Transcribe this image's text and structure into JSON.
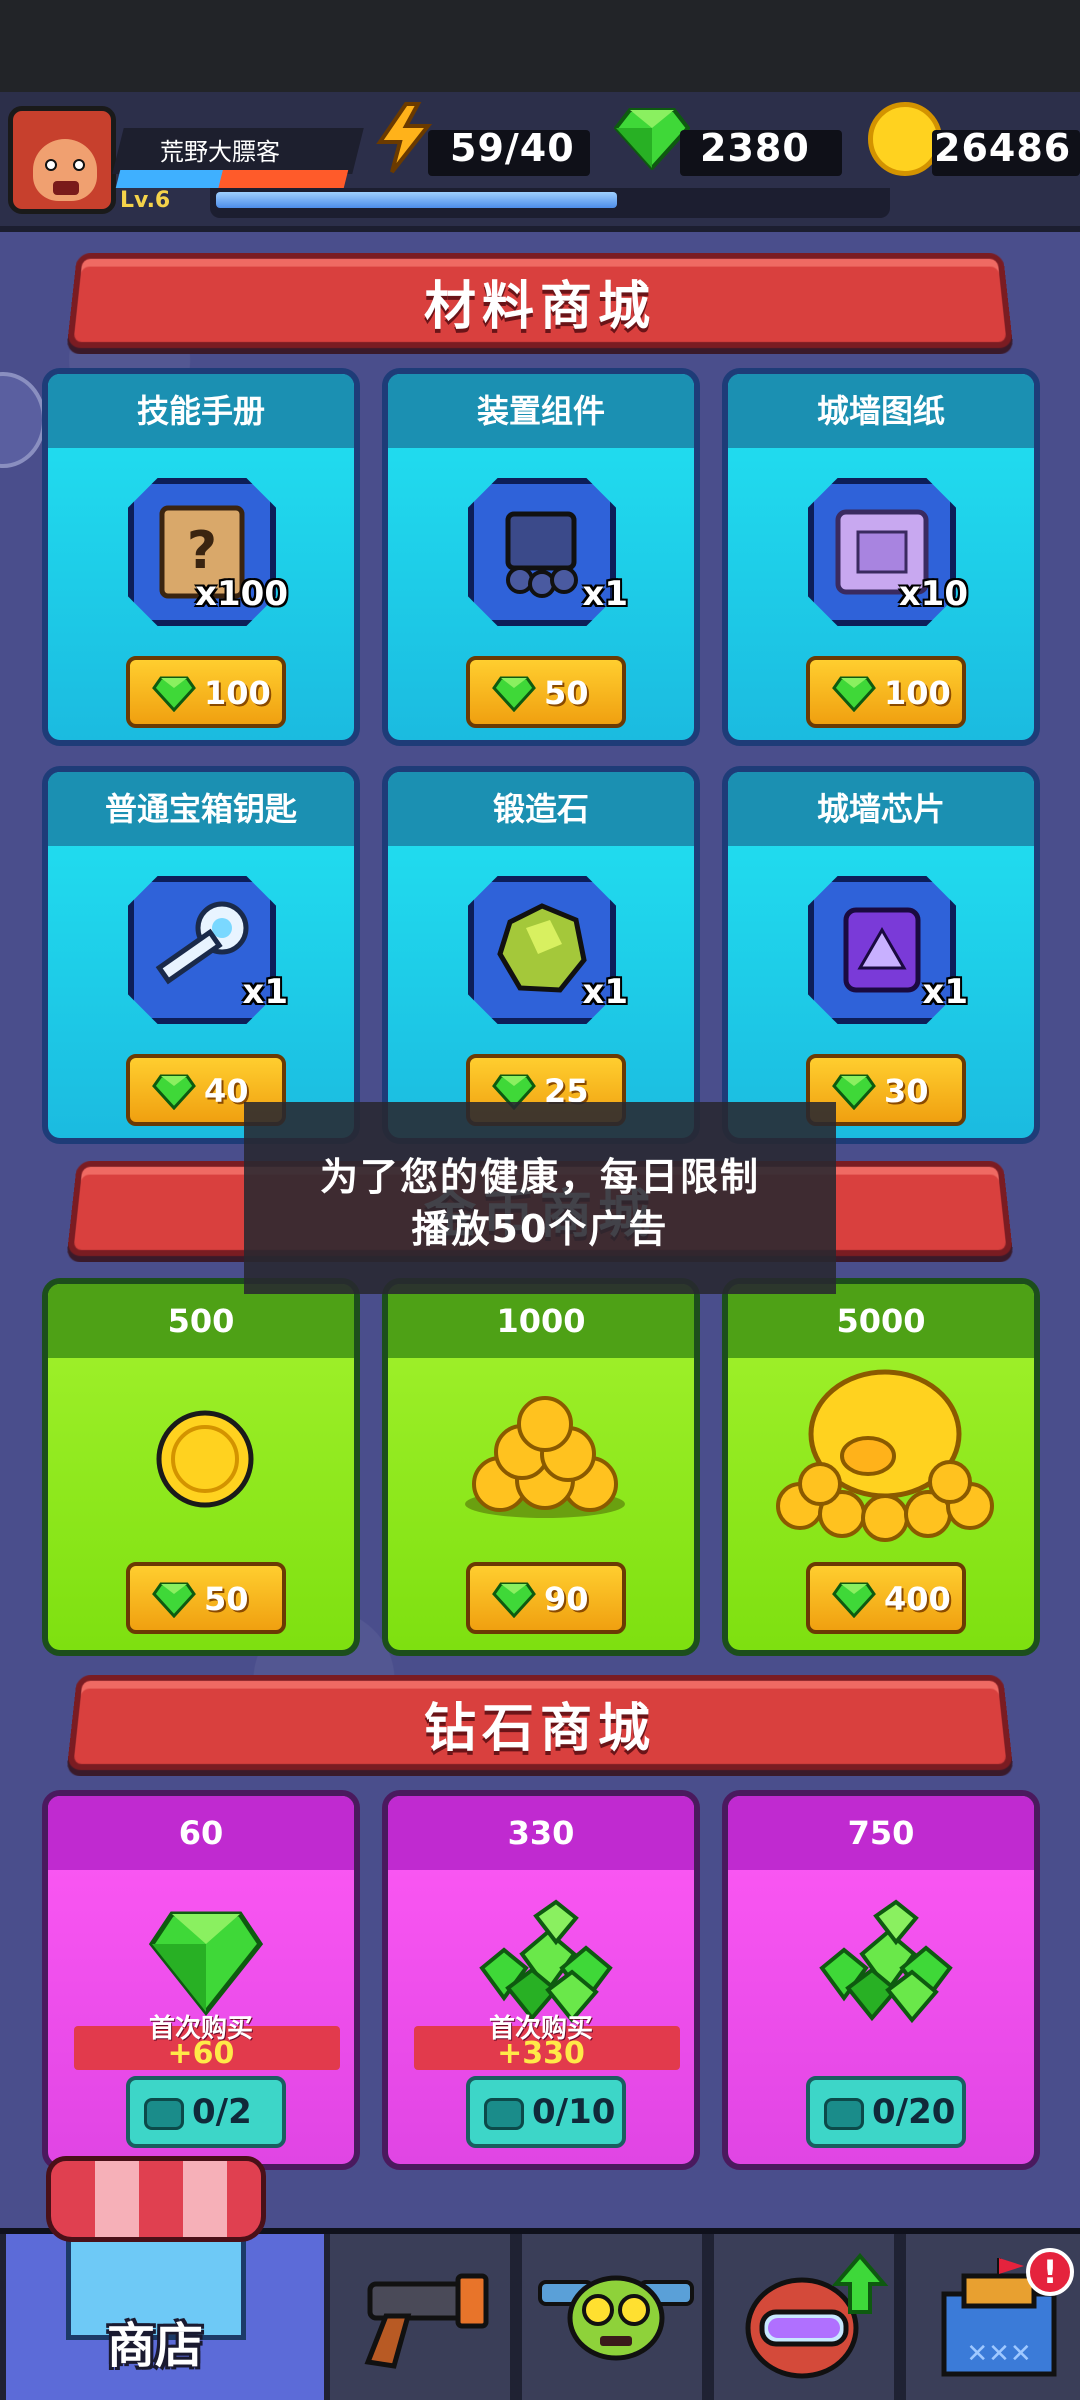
{
  "hud": {
    "player_name": "荒野大膘客",
    "level": "Lv.6",
    "energy": "59/40",
    "gems": "2380",
    "coins": "26486",
    "xp_fraction": 0.6
  },
  "sections": {
    "materials_title": "材料商城",
    "gold_title": "金币商城",
    "diamond_title": "钻石商城"
  },
  "materials": [
    {
      "name": "技能手册",
      "qty": "x100",
      "price": "100",
      "icon": "skill-book-icon"
    },
    {
      "name": "装置组件",
      "qty": "x1",
      "price": "50",
      "icon": "device-part-icon"
    },
    {
      "name": "城墙图纸",
      "qty": "x10",
      "price": "100",
      "icon": "wall-blueprint-icon"
    },
    {
      "name": "普通宝箱钥匙",
      "qty": "x1",
      "price": "40",
      "icon": "chest-key-icon"
    },
    {
      "name": "锻造石",
      "qty": "x1",
      "price": "25",
      "icon": "forge-stone-icon"
    },
    {
      "name": "城墙芯片",
      "qty": "x1",
      "price": "30",
      "icon": "wall-chip-icon"
    }
  ],
  "gold_packs": [
    {
      "amount": "500",
      "price": "50",
      "icon": "coin-icon"
    },
    {
      "amount": "1000",
      "price": "90",
      "icon": "coin-pile-icon"
    },
    {
      "amount": "5000",
      "price": "400",
      "icon": "golden-pig-icon"
    }
  ],
  "diamond_packs": [
    {
      "amount": "60",
      "first_buy_label": "首次购买",
      "first_buy_bonus": "+60",
      "ad_progress": "0/2"
    },
    {
      "amount": "330",
      "first_buy_label": "首次购买",
      "first_buy_bonus": "+330",
      "ad_progress": "0/10"
    },
    {
      "amount": "750",
      "ad_progress": "0/20"
    }
  ],
  "toast": {
    "line1": "为了您的健康，每日限制",
    "line2": "播放50个广告"
  },
  "nav": {
    "shop_label": "商店",
    "tabs": [
      "shop-icon",
      "gun-icon",
      "zombie-icon",
      "hero-upgrade-icon",
      "castle-icon"
    ],
    "alert_mark": "!"
  },
  "colors": {
    "background": "#4a4e8c",
    "banner_red": "#d9403e",
    "material_card": "#22e3f2",
    "gold_card": "#a4f22e",
    "diamond_card": "#ff5af5",
    "price_button": "#ffce2f",
    "gem_green": "#3fd838"
  }
}
